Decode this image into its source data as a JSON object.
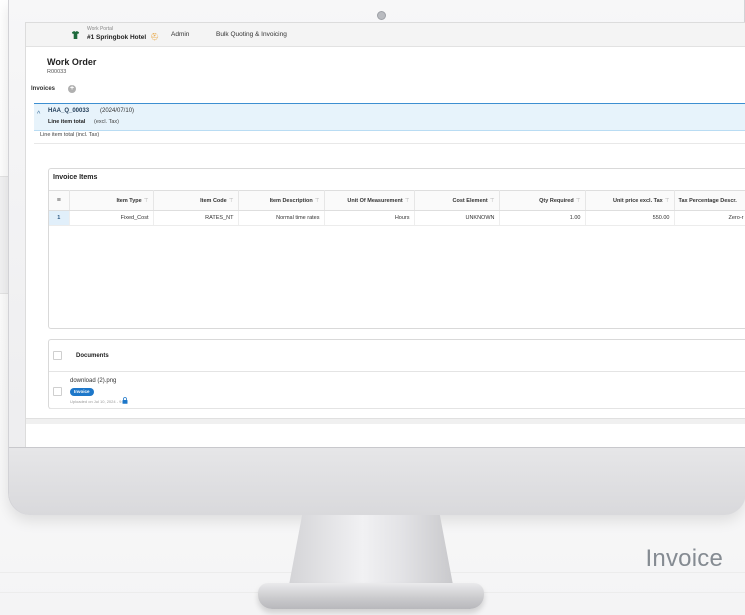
{
  "topbar": {
    "org_small": "Work Portal",
    "org_name": "#1 Springbok Hotel",
    "nav_admin": "Admin",
    "nav_bulk": "Bulk Quoting & Invoicing"
  },
  "work_order": {
    "title": "Work Order",
    "code": "R00033"
  },
  "invoices": {
    "label": "Invoices",
    "add_symbol": "+"
  },
  "quote": {
    "code": "HAA_Q_00033",
    "date": "(2024/07/10)",
    "line_total_label": "Line item total",
    "line_total_excl": "(excl. Tax)",
    "line_total_incl": "Line item total (incl. Tax)"
  },
  "invoice_items": {
    "title": "Invoice Items",
    "columns": [
      "Item Type",
      "Item Code",
      "Item Description",
      "Unit Of Measurement",
      "Cost Element",
      "Qty Required",
      "Unit price excl. Tax",
      "Tax Percentage Descr."
    ],
    "rows": [
      {
        "num": "1",
        "item_type": "Fixed_Cost",
        "item_code": "RATES_NT",
        "item_description": "Normal time rates",
        "unit": "Hours",
        "cost_element": "UNKNOWN",
        "qty": "1.00",
        "unit_price": "550.00",
        "tax": "Zero-r"
      }
    ]
  },
  "documents": {
    "title": "Documents",
    "file_name": "download (2).png",
    "badge": "Invoice",
    "uploaded": "Uploaded on Jul 10, 2024 - 9:06"
  },
  "caption": "Invoice",
  "colors": {
    "accent": "#1d77c9",
    "selected_row": "#e7f3fb",
    "brand_badge": "#e8a33a"
  },
  "icons": [
    "shirt-icon",
    "hat-icon",
    "add-circle-icon",
    "chevron-up-icon",
    "menu-icon",
    "filter-icon",
    "lock-icon",
    "camera-icon"
  ]
}
